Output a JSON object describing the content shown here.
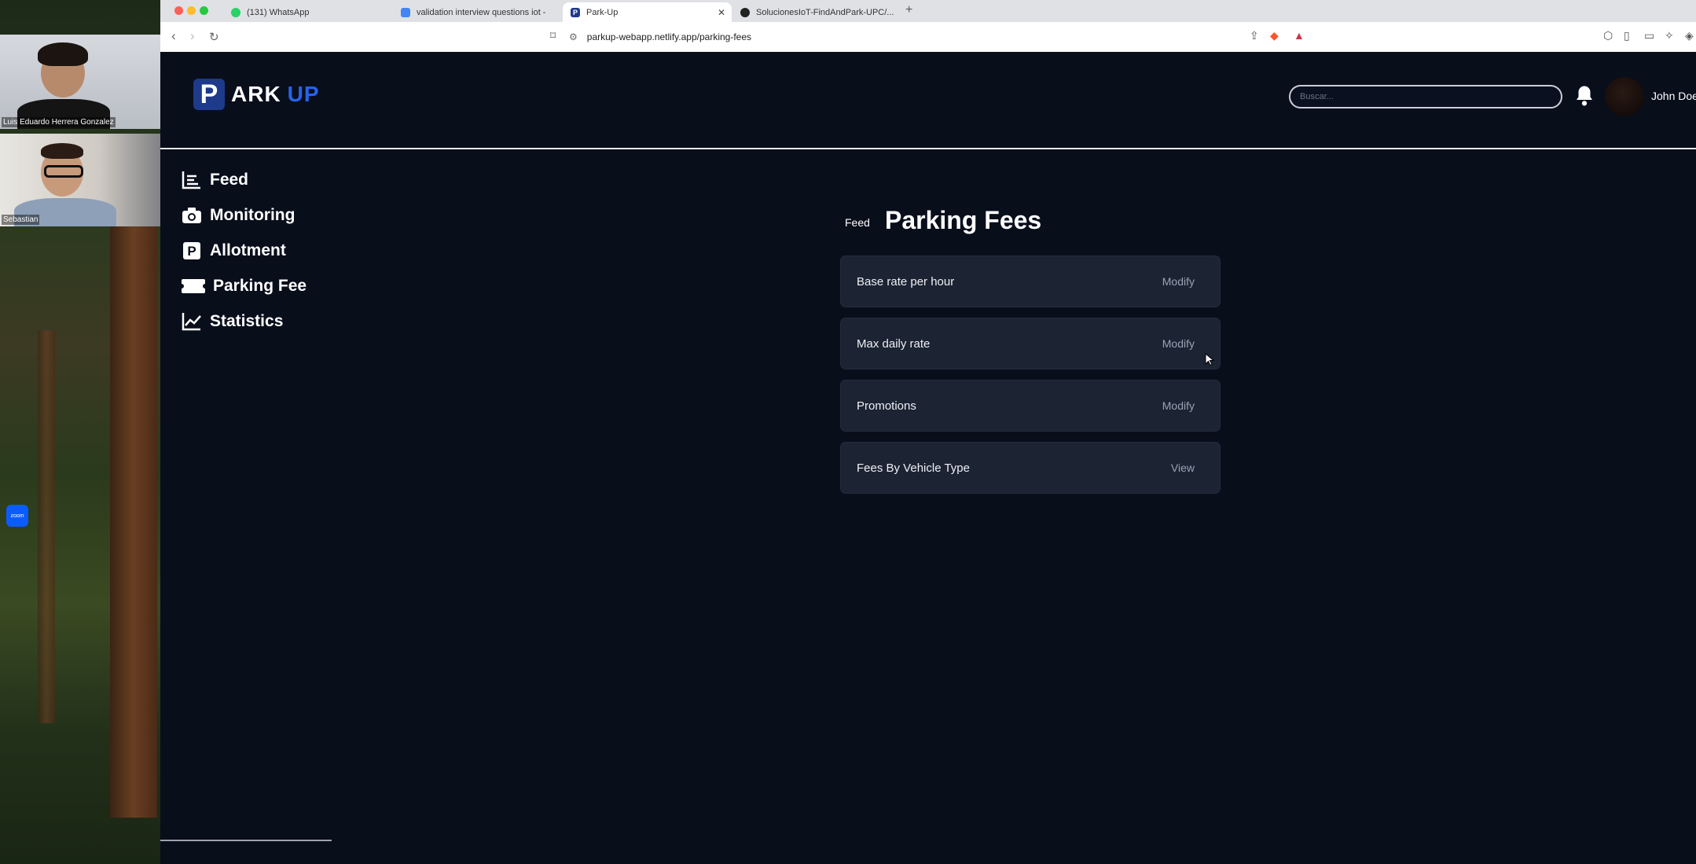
{
  "zoom": {
    "participants": [
      {
        "name": "Luis Eduardo Herrera Gonzalez"
      },
      {
        "name": "Sebastian"
      }
    ],
    "badge": "zoom"
  },
  "browser": {
    "tabs": [
      {
        "label": "(131) WhatsApp",
        "icon": "whatsapp-icon",
        "color": "#25d366"
      },
      {
        "label": "validation interview questions iot -",
        "icon": "google-docs-icon",
        "color": "#4285f4"
      },
      {
        "label": "Park-Up",
        "icon": "parkup-favicon",
        "color": "#1e3a8a"
      },
      {
        "label": "SolucionesIoT-FindAndPark-UPC/...",
        "icon": "github-icon",
        "color": "#222222"
      }
    ],
    "url": "parkup-webapp.netlify.app/parking-fees"
  },
  "app": {
    "logo": {
      "mark": "P",
      "text_a": "ARK",
      "text_b": "UP"
    },
    "search_placeholder": "Buscar...",
    "user_name": "John Doe",
    "sidebar": [
      {
        "label": "Feed",
        "icon": "feed-icon"
      },
      {
        "label": "Monitoring",
        "icon": "camera-icon"
      },
      {
        "label": "Allotment",
        "icon": "parking-icon"
      },
      {
        "label": "Parking Fee",
        "icon": "ticket-icon"
      },
      {
        "label": "Statistics",
        "icon": "chart-icon"
      }
    ],
    "breadcrumb": "Feed",
    "title": "Parking Fees",
    "fees": [
      {
        "label": "Base rate per hour",
        "action": "Modify"
      },
      {
        "label": "Max daily rate",
        "action": "Modify"
      },
      {
        "label": "Promotions",
        "action": "Modify"
      },
      {
        "label": "Fees By Vehicle Type",
        "action": "View"
      }
    ]
  },
  "colors": {
    "app_bg": "#090e1b",
    "card_bg": "#1c2333",
    "brand_blue": "#2563eb",
    "text_primary": "#ffffff",
    "text_muted": "#9aa2b3"
  }
}
